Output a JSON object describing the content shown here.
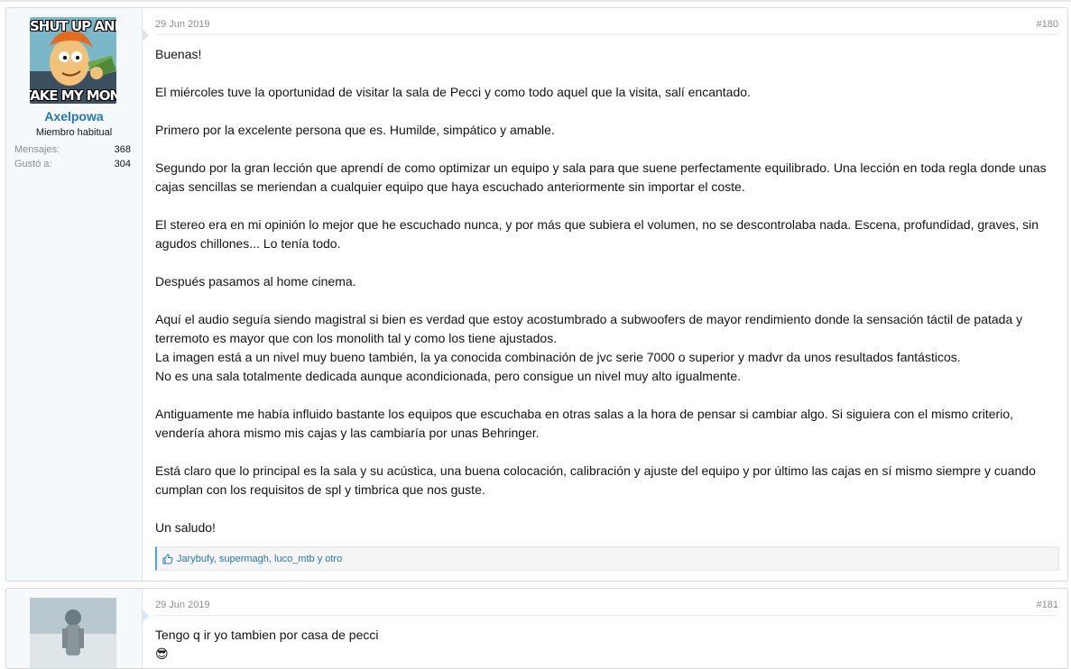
{
  "posts": [
    {
      "avatar_text_top": "SHUT UP AND",
      "avatar_text_bottom": "TAKE MY MONEY",
      "username": "Axelpowa",
      "user_title": "Miembro habitual",
      "stats": [
        {
          "label": "Mensajes:",
          "value": "368"
        },
        {
          "label": "Gustó a:",
          "value": "304"
        }
      ],
      "date": "29 Jun 2019",
      "post_number": "#180",
      "paragraphs": [
        "Buenas!",
        "El miércoles tuve la oportunidad de visitar la sala de Pecci y como todo aquel que la visita, salí encantado.",
        "Primero por la excelente persona que es. Humilde, simpático y amable.",
        "Segundo por la gran lección que aprendí de como optimizar un equipo y sala para que suene perfectamente equilibrado. Una lección en toda regla donde unas cajas sencillas se meriendan a cualquier equipo que haya escuchado anteriormente sin importar el coste.",
        "El stereo era en mi opinión lo mejor que he escuchado nunca, y por más que subiera el volumen, no se descontrolaba nada. Escena, profundidad, graves, sin agudos chillones... Lo tenía todo.",
        "Después pasamos al home cinema.",
        "Aquí el audio seguía siendo magistral si bien es verdad que estoy acostumbrado a subwoofers de mayor rendimiento donde la sensación táctil de patada y terremoto es mayor que con los monolith tal y como los tiene ajustados.",
        "La imagen está a un nivel muy bueno también, la ya conocida combinación de jvc serie 7000 o superior y madvr da unos resultados fantásticos.",
        "No es una sala totalmente dedicada aunque acondicionada, pero consigue un nivel muy alto igualmente.",
        "Antiguamente me había influido bastante los equipos que escuchaba en otras salas a la hora de pensar si cambiar algo. Si siguiera con el mismo criterio, vendería ahora mismo mis cajas y las cambiaría por unas Behringer.",
        "Está claro que lo principal es la sala y su acústica, una buena colocación, calibración y ajuste del equipo y por último las cajas en sí mismo siempre y cuando cumplan con los requisitos de spl y timbrica que nos guste.",
        "Un saludo!"
      ],
      "likes_text": "Jarybufy, supermagh, luco_mtb y otro"
    },
    {
      "date": "29 Jun 2019",
      "post_number": "#181",
      "paragraphs": [
        "Tengo q ir yo tambien por casa de pecci"
      ],
      "smiley": "😎"
    }
  ],
  "colors": {
    "accent": "#2577b1",
    "like_bar": "#47a7eb",
    "user_bg": "#f5f9fc"
  }
}
